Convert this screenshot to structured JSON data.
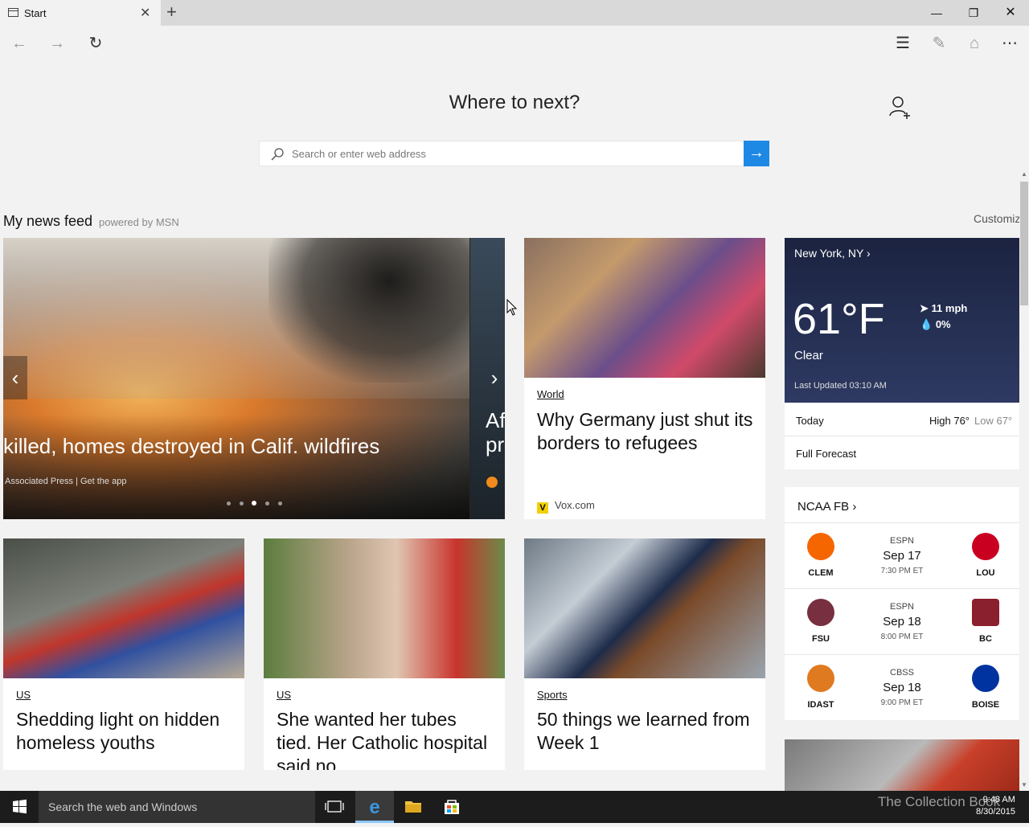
{
  "tab": {
    "title": "Start"
  },
  "hero": {
    "title": "Where to next?"
  },
  "search": {
    "placeholder": "Search or enter web address"
  },
  "feed": {
    "title": "My news feed",
    "powered": "powered by MSN",
    "customize": "Customiz"
  },
  "carousel": {
    "caption": "killed, homes destroyed in Calif. wildfires",
    "source": "Associated Press | Get the app",
    "next_caption_line1": "Af",
    "next_caption_line2": "pr",
    "slide_count": 5,
    "active_slide": 3
  },
  "cards": [
    {
      "category": "World",
      "headline": "Why Germany just shut its borders to refugees",
      "source": "Vox.com"
    },
    {
      "category": "US",
      "headline": "Shedding light on hidden homeless youths"
    },
    {
      "category": "US",
      "headline": "She wanted her tubes tied. Her Catholic hospital said no"
    },
    {
      "category": "Sports",
      "headline": "50 things we learned from Week 1"
    }
  ],
  "weather": {
    "city": "New York, NY",
    "temp": "61°F",
    "condition": "Clear",
    "wind": "11 mph",
    "precip": "0%",
    "updated": "Last Updated 03:10 AM",
    "today_label": "Today",
    "high": "High 76°",
    "low": "Low 67°",
    "full_forecast": "Full Forecast"
  },
  "ncaa": {
    "title": "NCAA FB",
    "games": [
      {
        "team1": "CLEM",
        "team2": "LOU",
        "network": "ESPN",
        "date": "Sep 17",
        "time": "7:30 PM ET"
      },
      {
        "team1": "FSU",
        "team2": "BC",
        "network": "ESPN",
        "date": "Sep 18",
        "time": "8:00 PM ET"
      },
      {
        "team1": "IDAST",
        "team2": "BOISE",
        "network": "CBSS",
        "date": "Sep 18",
        "time": "9:00 PM ET"
      }
    ]
  },
  "taskbar": {
    "search_placeholder": "Search the web and Windows",
    "watermark": "The Collection Book",
    "time": "9:48 AM",
    "date": "8/30/2015"
  },
  "colors": {
    "accent": "#1e88e5",
    "weather_bg": "#1b2340",
    "taskbar_bg": "#1c1c1c"
  },
  "icons": [
    "tab-page-icon",
    "close-icon",
    "plus-icon",
    "minimize-icon",
    "restore-icon",
    "back-arrow-icon",
    "forward-arrow-icon",
    "refresh-icon",
    "hub-icon",
    "web-note-icon",
    "share-icon",
    "more-icon",
    "add-person-icon",
    "search-icon",
    "arrow-right-icon",
    "chevron-left-icon",
    "chevron-right-icon",
    "windows-logo-icon",
    "task-view-icon",
    "edge-icon",
    "folder-icon",
    "store-icon"
  ]
}
